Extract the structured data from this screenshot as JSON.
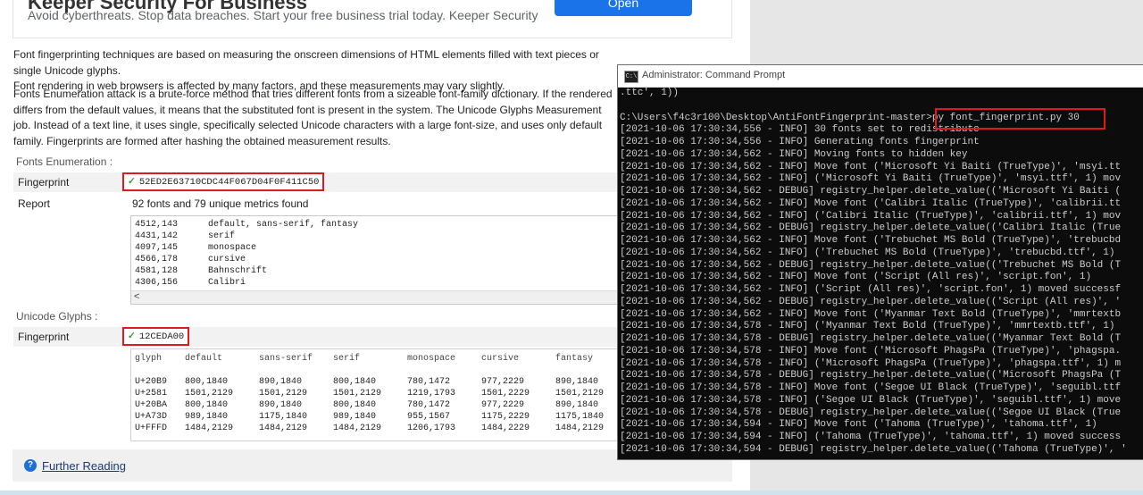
{
  "ad": {
    "title": "Keeper Security For Business",
    "description": "Avoid cyberthreats. Stop data breaches. Start your free business trial today. Keeper Security",
    "button": "Open"
  },
  "paragraphs": {
    "p1_line1": "Font fingerprinting techniques are based on measuring the onscreen dimensions of HTML elements filled with text pieces or single Unicode glyphs.",
    "p1_line2": "Font rendering in web browsers is affected by many factors, and these measurements may vary slightly.",
    "p2_line1": "Fonts Enumeration attack is a brute-force method that tries different fonts from a sizeable font-family dictionary. If the rendered",
    "p2_line2": "differs from the default values, it means that the substituted font is present in the system. The Unicode Glyphs Measurement",
    "p2_line3": "job. Instead of a text line, it uses single, specifically selected Unicode characters with a large font-size, and uses only default",
    "p2_line4": "family. Fingerprints are formed after hashing the obtained measurement results."
  },
  "fonts_enum": {
    "section_label": "Fonts Enumeration :",
    "fingerprint_label": "Fingerprint",
    "fingerprint_value": "52ED2E63710CDC44F067D04F0F411C50",
    "report_label": "Report",
    "report_text": "92 fonts and 79 unique metrics found",
    "metrics": [
      {
        "size": "4512,143",
        "fonts": "default, sans-serif, fantasy"
      },
      {
        "size": "4431,142",
        "fonts": "serif"
      },
      {
        "size": "4097,145",
        "fonts": "monospace"
      },
      {
        "size": "4566,178",
        "fonts": "cursive"
      },
      {
        "size": "4581,128",
        "fonts": "Bahnschrift"
      },
      {
        "size": "4306,156",
        "fonts": "Calibri"
      }
    ],
    "scroll_arrow": "<"
  },
  "unicode": {
    "section_label": "Unicode Glyphs :",
    "fingerprint_label": "Fingerprint",
    "fingerprint_value": "12CEDA00",
    "headers": [
      "glyph",
      "default",
      "sans-serif",
      "serif",
      "monospace",
      "cursive",
      "fantasy"
    ],
    "rows": [
      [
        "U+20B9",
        "800,1840",
        "890,1840",
        "800,1840",
        "780,1472",
        "977,2229",
        "890,1840"
      ],
      [
        "U+2581",
        "1501,2129",
        "1501,2129",
        "1501,2129",
        "1219,1793",
        "1501,2229",
        "1501,2129"
      ],
      [
        "U+20BA",
        "800,1840",
        "890,1840",
        "800,1840",
        "780,1472",
        "977,2229",
        "890,1840"
      ],
      [
        "U+A73D",
        "989,1840",
        "1175,1840",
        "989,1840",
        "955,1567",
        "1175,2229",
        "1175,1840"
      ],
      [
        "U+FFFD",
        "1484,2129",
        "1484,2129",
        "1484,2129",
        "1206,1793",
        "1484,2229",
        "1484,2129"
      ]
    ]
  },
  "further_reading": {
    "icon": "question-icon",
    "label": "Further Reading"
  },
  "cmd": {
    "title": "Administrator: Command Prompt",
    "lines": [
      ".ttc', 1))",
      "",
      "C:\\Users\\f4c3r100\\Desktop\\AntiFontFingerprint-master>py font_fingerprint.py 30",
      "[2021-10-06 17:30:34,556 - INFO] 30 fonts set to redistribute",
      "[2021-10-06 17:30:34,556 - INFO] Generating fonts fingerprint",
      "[2021-10-06 17:30:34,562 - INFO] Moving fonts to hidden key",
      "[2021-10-06 17:30:34,562 - INFO] Move font ('Microsoft Yi Baiti (TrueType)', 'msyi.tt",
      "[2021-10-06 17:30:34,562 - INFO] ('Microsoft Yi Baiti (TrueType)', 'msyi.ttf', 1) mov",
      "[2021-10-06 17:30:34,562 - DEBUG] registry_helper.delete_value(('Microsoft Yi Baiti (",
      "[2021-10-06 17:30:34,562 - INFO] Move font ('Calibri Italic (TrueType)', 'calibrii.tt",
      "[2021-10-06 17:30:34,562 - INFO] ('Calibri Italic (TrueType)', 'calibrii.ttf', 1) mov",
      "[2021-10-06 17:30:34,562 - DEBUG] registry_helper.delete_value(('Calibri Italic (True",
      "[2021-10-06 17:30:34,562 - INFO] Move font ('Trebuchet MS Bold (TrueType)', 'trebucbd",
      "[2021-10-06 17:30:34,562 - INFO] ('Trebuchet MS Bold (TrueType)', 'trebucbd.ttf', 1)",
      "[2021-10-06 17:30:34,562 - DEBUG] registry_helper.delete_value(('Trebuchet MS Bold (T",
      "[2021-10-06 17:30:34,562 - INFO] Move font ('Script (All res)', 'script.fon', 1)",
      "[2021-10-06 17:30:34,562 - INFO] ('Script (All res)', 'script.fon', 1) moved successf",
      "[2021-10-06 17:30:34,562 - DEBUG] registry_helper.delete_value(('Script (All res)', '",
      "[2021-10-06 17:30:34,562 - INFO] Move font ('Myanmar Text Bold (TrueType)', 'mmrtextb",
      "[2021-10-06 17:30:34,578 - INFO] ('Myanmar Text Bold (TrueType)', 'mmrtextb.ttf', 1)",
      "[2021-10-06 17:30:34,578 - DEBUG] registry_helper.delete_value(('Myanmar Text Bold (T",
      "[2021-10-06 17:30:34,578 - INFO] Move font ('Microsoft PhagsPa (TrueType)', 'phagspa.",
      "[2021-10-06 17:30:34,578 - INFO] ('Microsoft PhagsPa (TrueType)', 'phagspa.ttf', 1) m",
      "[2021-10-06 17:30:34,578 - DEBUG] registry_helper.delete_value(('Microsoft PhagsPa (T",
      "[2021-10-06 17:30:34,578 - INFO] Move font ('Segoe UI Black (TrueType)', 'seguibl.ttf",
      "[2021-10-06 17:30:34,578 - INFO] ('Segoe UI Black (TrueType)', 'seguibl.ttf', 1) move",
      "[2021-10-06 17:30:34,578 - DEBUG] registry_helper.delete_value(('Segoe UI Black (True",
      "[2021-10-06 17:30:34,594 - INFO] Move font ('Tahoma (TrueType)', 'tahoma.ttf', 1)",
      "[2021-10-06 17:30:34,594 - INFO] ('Tahoma (TrueType)', 'tahoma.ttf', 1) moved success",
      "[2021-10-06 17:30:34,594 - DEBUG] registry_helper.delete_value(('Tahoma (TrueType)', '"
    ]
  }
}
